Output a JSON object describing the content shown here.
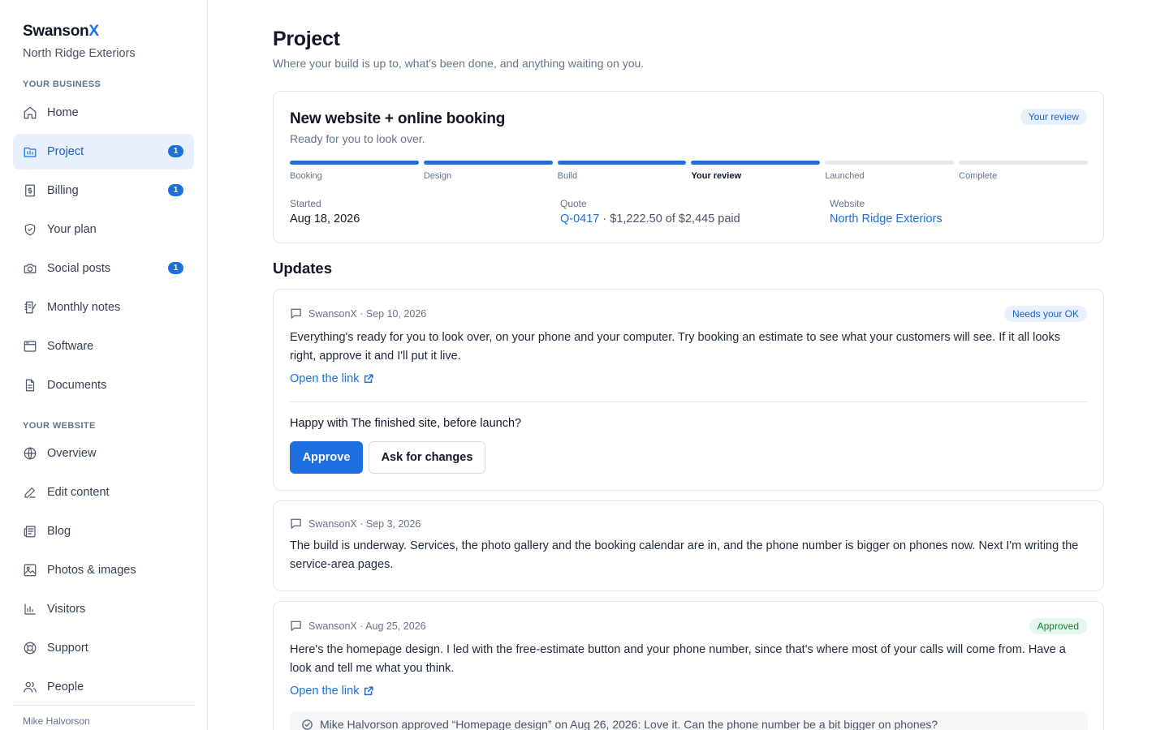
{
  "sidebar": {
    "brand": {
      "name": "Swanson",
      "accent": "X"
    },
    "business_name": "North Ridge Exteriors",
    "sections": {
      "business": "YOUR BUSINESS",
      "website": "YOUR WEBSITE"
    },
    "items": [
      {
        "label": "Home",
        "icon": "home-icon"
      },
      {
        "label": "Project",
        "icon": "project-icon",
        "badge": "1",
        "active": true
      },
      {
        "label": "Billing",
        "icon": "billing-icon",
        "badge": "1"
      },
      {
        "label": "Your plan",
        "icon": "shield-icon"
      },
      {
        "label": "Social posts",
        "icon": "camera-icon",
        "badge": "1"
      },
      {
        "label": "Monthly notes",
        "icon": "notes-icon"
      },
      {
        "label": "Software",
        "icon": "window-icon"
      },
      {
        "label": "Documents",
        "icon": "document-icon"
      },
      {
        "label": "Overview",
        "icon": "globe-icon"
      },
      {
        "label": "Edit content",
        "icon": "pencil-icon"
      },
      {
        "label": "Blog",
        "icon": "newspaper-icon"
      },
      {
        "label": "Photos & images",
        "icon": "image-icon"
      },
      {
        "label": "Visitors",
        "icon": "bar-chart-icon"
      },
      {
        "label": "Support",
        "icon": "lifebuoy-icon"
      },
      {
        "label": "People",
        "icon": "people-icon"
      }
    ],
    "user_name": "Mike Halvorson"
  },
  "page": {
    "title": "Project",
    "subtitle": "Where your build is up to, what's been done, and anything waiting on you."
  },
  "project": {
    "title": "New website + online booking",
    "subtitle": "Ready for you to look over.",
    "status": "Your review",
    "steps": [
      {
        "label": "Booking",
        "done": true
      },
      {
        "label": "Design",
        "done": true
      },
      {
        "label": "Build",
        "done": true
      },
      {
        "label": "Your review",
        "done": true,
        "current": true
      },
      {
        "label": "Launched",
        "done": false
      },
      {
        "label": "Complete",
        "done": false
      }
    ],
    "started_label": "Started",
    "started_value": "Aug 18, 2026",
    "quote_label": "Quote",
    "quote_id": "Q-0417",
    "quote_detail": " · $1,222.50 of $2,445 paid",
    "website_label": "Website",
    "website_value": "North Ridge Exteriors"
  },
  "updates": {
    "heading": "Updates",
    "items": [
      {
        "meta": "SwansonX · Sep 10, 2026",
        "status": "Needs your OK",
        "body": "Everything's ready for you to look over, on your phone and your computer. Try booking an estimate to see what your customers will see. If it all looks right, approve it and I'll put it live.",
        "link": "Open the link",
        "question": "Happy with The finished site, before launch?",
        "approve": "Approve",
        "changes": "Ask for changes"
      },
      {
        "meta": "SwansonX · Sep 3, 2026",
        "body": "The build is underway. Services, the photo gallery and the booking calendar are in, and the phone number is bigger on phones now. Next I'm writing the service-area pages."
      },
      {
        "meta": "SwansonX · Aug 25, 2026",
        "status": "Approved",
        "body": "Here's the homepage design. I led with the free-estimate button and your phone number, since that's where most of your calls will come from. Have a look and tell me what you think.",
        "link": "Open the link",
        "note": "Mike Halvorson approved “Homepage design” on Aug 26, 2026: Love it. Can the phone number be a bit bigger on phones?"
      }
    ]
  },
  "colors": {
    "accent": "#1d6fe0",
    "active_bg": "#e8f0fd",
    "approved": "#15803d"
  }
}
